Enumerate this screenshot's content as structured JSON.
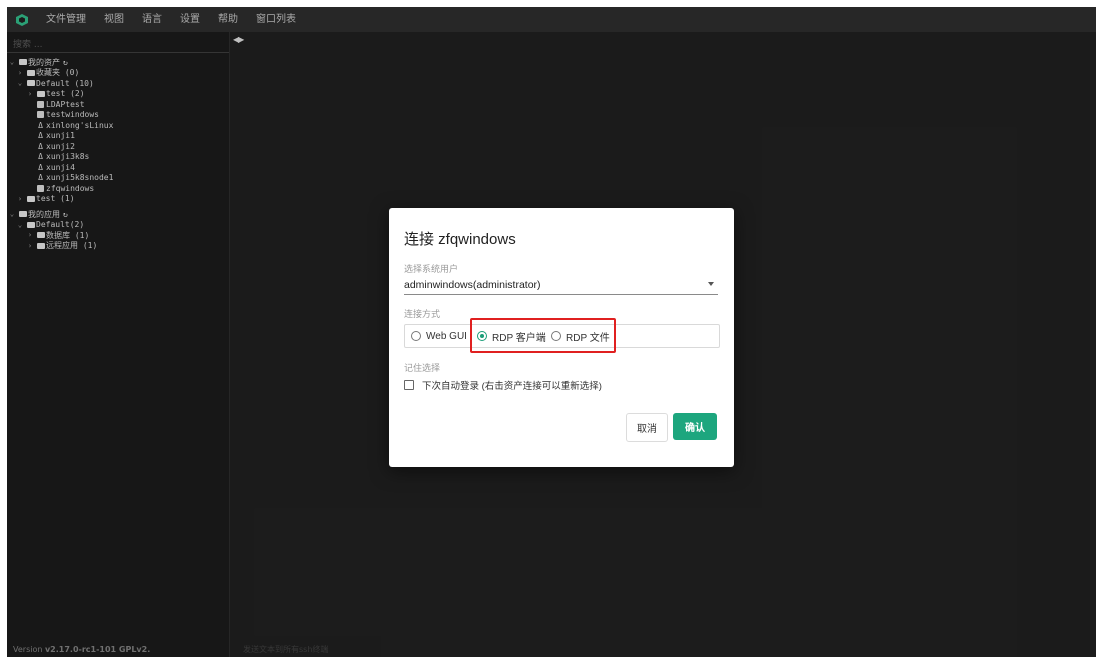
{
  "menubar": {
    "items": [
      "文件管理",
      "视图",
      "语言",
      "设置",
      "帮助",
      "窗口列表"
    ]
  },
  "sidebar": {
    "search_placeholder": "搜索 ...",
    "assets_root": "我的资产",
    "favorites": "收藏夹 (0)",
    "default_group": "Default (10)",
    "test_group_inner": "test (2)",
    "hosts": [
      {
        "name": "LDAPtest",
        "os": "windows"
      },
      {
        "name": "testwindows",
        "os": "windows"
      },
      {
        "name": "xinlong'sLinux",
        "os": "linux"
      },
      {
        "name": "xunji1",
        "os": "linux"
      },
      {
        "name": "xunji2",
        "os": "linux"
      },
      {
        "name": "xunji3k8s",
        "os": "linux"
      },
      {
        "name": "xunji4",
        "os": "linux"
      },
      {
        "name": "xunji5k8snode1",
        "os": "linux"
      },
      {
        "name": "zfqwindows",
        "os": "windows"
      }
    ],
    "test_group_outer": "test (1)",
    "apps_root": "我的应用",
    "apps_default": "Default(2)",
    "apps_db": "数据库 (1)",
    "apps_remote": "远程应用 (1)"
  },
  "footer": {
    "version_prefix": "Version ",
    "version": "v2.17.0-rc1-101 GPLv2.",
    "status_hint": "发送文本到所有ssh终端"
  },
  "dialog": {
    "title": "连接 zfqwindows",
    "user_label": "选择系统用户",
    "user_value": "adminwindows(administrator)",
    "method_label": "连接方式",
    "methods": [
      "Web GUI",
      "RDP 客户端",
      "RDP 文件"
    ],
    "selected_method": "RDP 客户端",
    "remember_label": "记住选择",
    "remember_checkbox": "下次自动登录 (右击资产连接可以重新选择)",
    "cancel": "取消",
    "confirm": "确认"
  },
  "colors": {
    "accent": "#1da67e",
    "highlight": "#e02020",
    "background": "#1e1e1e"
  }
}
